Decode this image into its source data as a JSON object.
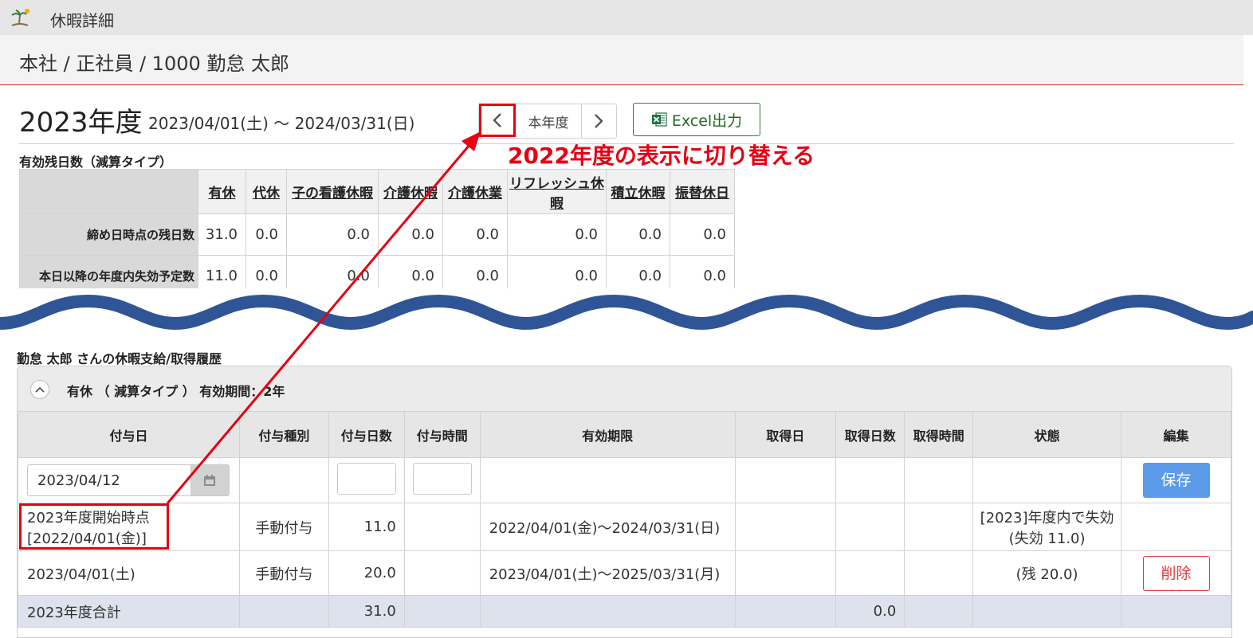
{
  "window": {
    "title": "休暇詳細",
    "icon": "vacation-beach-icon"
  },
  "breadcrumb": "本社 / 正社員 / 1000 勤怠 太郎",
  "fiscal_year": {
    "label": "2023年度",
    "range": "2023/04/01(土) ～ 2024/03/31(日)",
    "nav": {
      "prev_icon": "chevron-left-icon",
      "current_label": "本年度",
      "next_icon": "chevron-right-icon"
    },
    "excel_button": "Excel出力"
  },
  "annotation": {
    "text": "2022年度の表示に切り替える",
    "color": "#e60012"
  },
  "remaining": {
    "title": "有効残日数（減算タイプ）",
    "columns": [
      "有休",
      "代休",
      "子の看護休暇",
      "介護休暇",
      "介護休業",
      "リフレッシュ休暇",
      "積立休暇",
      "振替休日"
    ],
    "rows": [
      {
        "label": "締め日時点の残日数",
        "values": [
          "31.0",
          "0.0",
          "0.0",
          "0.0",
          "0.0",
          "0.0",
          "0.0",
          "0.0"
        ]
      },
      {
        "label": "本日以降の年度内失効予定数",
        "values": [
          "11.0",
          "0.0",
          "0.0",
          "0.0",
          "0.0",
          "0.0",
          "0.0",
          "0.0"
        ]
      }
    ]
  },
  "history": {
    "title": "勤怠 太郎 さんの休暇支給/取得履歴",
    "panel_title": "有休 （ 減算タイプ ） 有効期間：2年",
    "columns": [
      "付与日",
      "付与種別",
      "付与日数",
      "付与時間",
      "有効期限",
      "取得日",
      "取得日数",
      "取得時間",
      "状態",
      "編集"
    ],
    "input_row": {
      "date_value": "2023/04/12",
      "save_label": "保存"
    },
    "rows": [
      {
        "grant_date_line1": "2023年度開始時点",
        "grant_date_line2": "[2022/04/01(金)]",
        "type": "手動付与",
        "days": "11.0",
        "hours": "",
        "expiry": "2022/04/01(金)～2024/03/31(日)",
        "status_line1": "[2023]年度内で失効",
        "status_line2": "(失効 11.0)"
      },
      {
        "grant_date": "2023/04/01(土)",
        "type": "手動付与",
        "days": "20.0",
        "hours": "",
        "expiry": "2023/04/01(土)～2025/03/31(月)",
        "status": "(残 20.0)",
        "delete_label": "削除"
      }
    ],
    "total_row": {
      "label": "2023年度合計",
      "days": "31.0",
      "taken_days": "0.0"
    }
  },
  "colors": {
    "accent_red": "#e60012",
    "save_blue": "#5b9bea",
    "excel_green": "#2e7d32",
    "wave_blue": "#2f5597",
    "total_row_bg": "#dde2ec"
  }
}
